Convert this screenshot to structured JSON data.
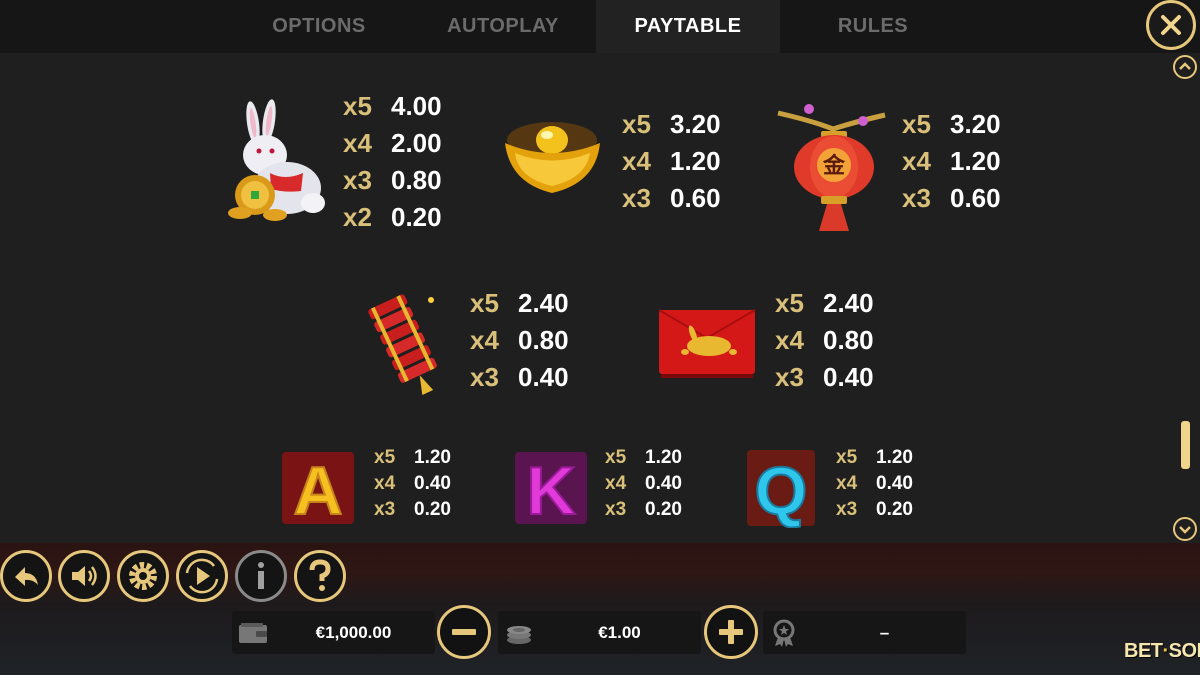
{
  "tabs": [
    {
      "label": "OPTIONS",
      "active": false
    },
    {
      "label": "AUTOPLAY",
      "active": false
    },
    {
      "label": "PAYTABLE",
      "active": true
    },
    {
      "label": "RULES",
      "active": false
    }
  ],
  "paytable": {
    "symbols": [
      {
        "icon": "rabbit-symbol-icon",
        "pays": [
          {
            "mult": "x5",
            "value": "4.00"
          },
          {
            "mult": "x4",
            "value": "2.00"
          },
          {
            "mult": "x3",
            "value": "0.80"
          },
          {
            "mult": "x2",
            "value": "0.20"
          }
        ]
      },
      {
        "icon": "gold-ingot-symbol-icon",
        "pays": [
          {
            "mult": "x5",
            "value": "3.20"
          },
          {
            "mult": "x4",
            "value": "1.20"
          },
          {
            "mult": "x3",
            "value": "0.60"
          }
        ]
      },
      {
        "icon": "lantern-symbol-icon",
        "glyph": "金",
        "pays": [
          {
            "mult": "x5",
            "value": "3.20"
          },
          {
            "mult": "x4",
            "value": "1.20"
          },
          {
            "mult": "x3",
            "value": "0.60"
          }
        ]
      },
      {
        "icon": "firecrackers-symbol-icon",
        "pays": [
          {
            "mult": "x5",
            "value": "2.40"
          },
          {
            "mult": "x4",
            "value": "0.80"
          },
          {
            "mult": "x3",
            "value": "0.40"
          }
        ]
      },
      {
        "icon": "red-envelope-symbol-icon",
        "pays": [
          {
            "mult": "x5",
            "value": "2.40"
          },
          {
            "mult": "x4",
            "value": "0.80"
          },
          {
            "mult": "x3",
            "value": "0.40"
          }
        ]
      },
      {
        "icon": "letter-a-symbol-icon",
        "glyph": "A",
        "pays": [
          {
            "mult": "x5",
            "value": "1.20"
          },
          {
            "mult": "x4",
            "value": "0.40"
          },
          {
            "mult": "x3",
            "value": "0.20"
          }
        ]
      },
      {
        "icon": "letter-k-symbol-icon",
        "glyph": "K",
        "pays": [
          {
            "mult": "x5",
            "value": "1.20"
          },
          {
            "mult": "x4",
            "value": "0.40"
          },
          {
            "mult": "x3",
            "value": "0.20"
          }
        ]
      },
      {
        "icon": "letter-q-symbol-icon",
        "glyph": "Q",
        "pays": [
          {
            "mult": "x5",
            "value": "1.20"
          },
          {
            "mult": "x4",
            "value": "0.40"
          },
          {
            "mult": "x3",
            "value": "0.20"
          }
        ]
      }
    ]
  },
  "scroll": {
    "position": 0.85
  },
  "controls": {
    "balance": "€1,000.00",
    "bet": "€1.00",
    "win": "–"
  },
  "brand": {
    "logo_left": "BET",
    "logo_right": "SOFT"
  },
  "colors": {
    "accent": "#e6c77b",
    "multiplier": "#d9c07a",
    "background": "#1f1f1f"
  }
}
